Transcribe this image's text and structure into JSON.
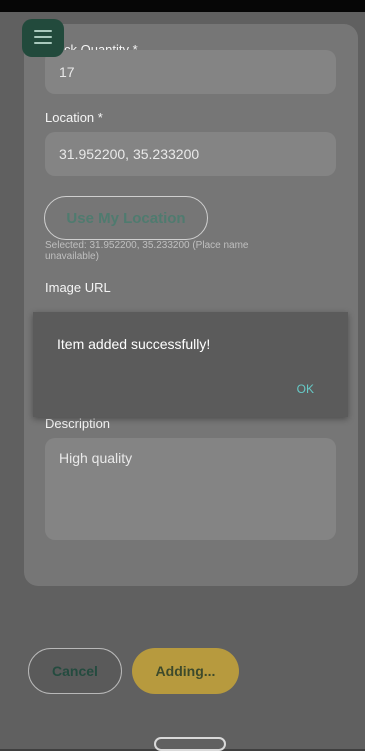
{
  "form": {
    "stock_quantity_label": "ck Quantity *",
    "stock_quantity_value": "17",
    "location_label": "Location *",
    "location_value": "31.952200, 35.233200",
    "use_location_button": "Use My Location",
    "selected_location_text": "Selected: 31.952200, 35.233200 (Place name unavailable)",
    "image_url_label": "Image URL",
    "description_label": "Description",
    "description_value": "High quality"
  },
  "menu": {
    "icon": "hamburger-menu-icon"
  },
  "dialog": {
    "message": "Item added successfully!",
    "ok_label": "OK"
  },
  "actions": {
    "cancel_label": "Cancel",
    "submit_label": "Adding..."
  },
  "colors": {
    "accent_green": "#224a3c",
    "submit_amber": "#b79a3e",
    "dialog_ok": "#66c9c6"
  }
}
